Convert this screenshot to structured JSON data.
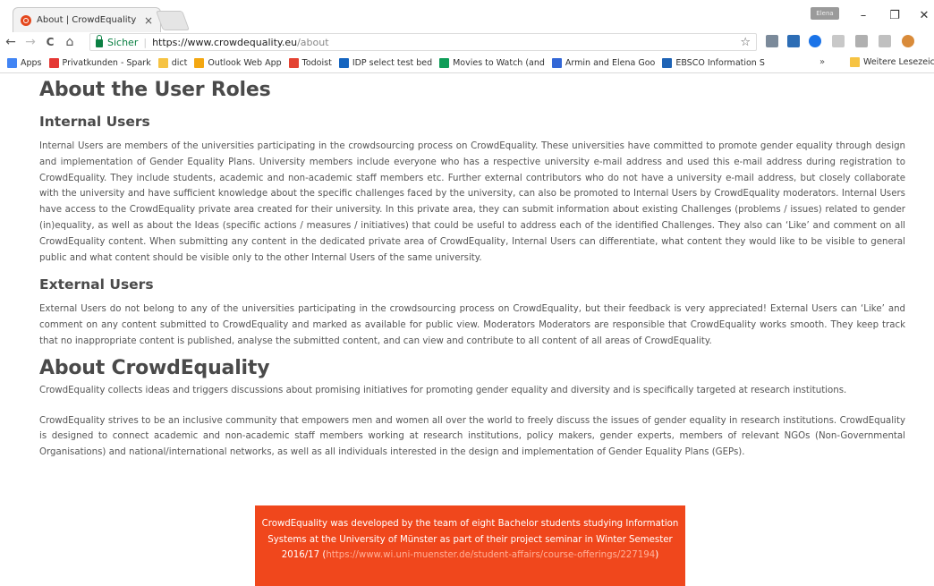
{
  "browser": {
    "tab_title": "About | CrowdEquality",
    "tab_close": "×",
    "profile_label": "Elena",
    "window_controls": {
      "minimize": "–",
      "maximize": "❐",
      "close": "✕"
    },
    "nav": {
      "back": "←",
      "forward": "→",
      "reload": "C",
      "home": "⌂"
    },
    "secure_label": "Sicher",
    "url_host": "https://www.crowdequality.eu",
    "url_path": "/about",
    "star": "☆"
  },
  "bookmarks": {
    "items": [
      {
        "label": "Apps",
        "color": "#4285f4"
      },
      {
        "label": "Privatkunden - Spark",
        "color": "#e53935"
      },
      {
        "label": "dict",
        "color": "#f6c343"
      },
      {
        "label": "Outlook Web App",
        "color": "#f3a712"
      },
      {
        "label": "Todoist",
        "color": "#e44332"
      },
      {
        "label": "IDP select test bed",
        "color": "#1565c0"
      },
      {
        "label": "Movies to Watch (and",
        "color": "#0f9d58"
      },
      {
        "label": "Armin and Elena Goo",
        "color": "#3367d6"
      },
      {
        "label": "EBSCO Information S",
        "color": "#1e63b5"
      }
    ],
    "more": "»",
    "other_label": "Weitere Lesezeichen",
    "other_color": "#f6c343"
  },
  "page": {
    "roles_title": "About the User Roles",
    "internal": {
      "title": "Internal Users",
      "text": "Internal Users are members of the universities participating in the crowdsourcing process on CrowdEquality. These universities have committed to promote gender equality through design and implementation of Gender Equality Plans. University members include everyone who has a respective university e-mail address and used this e-mail address during registration to CrowdEquality. They include students, academic and non-academic staff members etc. Further external contributors who do not have a university e-mail address, but closely collaborate with the university and have sufficient knowledge about the specific challenges faced by the university, can also be promoted to Internal Users by CrowdEquality moderators. Internal Users have access to the CrowdEquality private area created for their university. In this private area, they can submit information about existing Challenges (problems / issues) related to gender (in)equality, as well as about the Ideas (specific actions / measures / initiatives) that could be useful to address each of the identified Challenges. They also can ‘Like’ and comment on all CrowdEquality content. When submitting any content in the dedicated private area of CrowdEquality, Internal Users can differentiate, what content they would like to be visible to general public and what content should be visible only to the other Internal Users of the same university."
    },
    "external": {
      "title": "External Users",
      "text": "External Users do not belong to any of the universities participating in the crowdsourcing process on CrowdEquality, but their feedback is very appreciated! External Users can ‘Like’ and comment on any content submitted to CrowdEquality and marked as available for public view. Moderators Moderators are responsible that CrowdEquality works smooth. They keep track that no inappropriate content is published, analyse the submitted content, and can view and contribute to all content of all areas of CrowdEquality."
    },
    "about": {
      "title": "About CrowdEquality",
      "p1": "CrowdEquality collects ideas and triggers discussions about promising initiatives for promoting gender equality and diversity and is specifically targeted at research institutions.",
      "p2": "CrowdEquality strives to be an inclusive community that empowers men and women all over the world to freely discuss the issues of gender equality in research institutions. CrowdEquality is designed to connect academic and non-academic staff members working at research institutions, policy makers, gender experts, members of relevant NGOs (Non-Governmental Organisations) and national/international networks, as well as all individuals interested in the design and implementation of Gender Equality Plans (GEPs)."
    },
    "credit": {
      "text_before": "CrowdEquality was developed by the team of eight Bachelor students studying Information Systems at the University of Münster as part of their project seminar in Winter Semester 2016/17 (",
      "link": "https://www.wi.uni-muenster.de/student-affairs/course-offerings/227194",
      "text_after": ")"
    }
  },
  "colors": {
    "credit_bg": "#f0471c",
    "secure_green": "#0b8043"
  }
}
